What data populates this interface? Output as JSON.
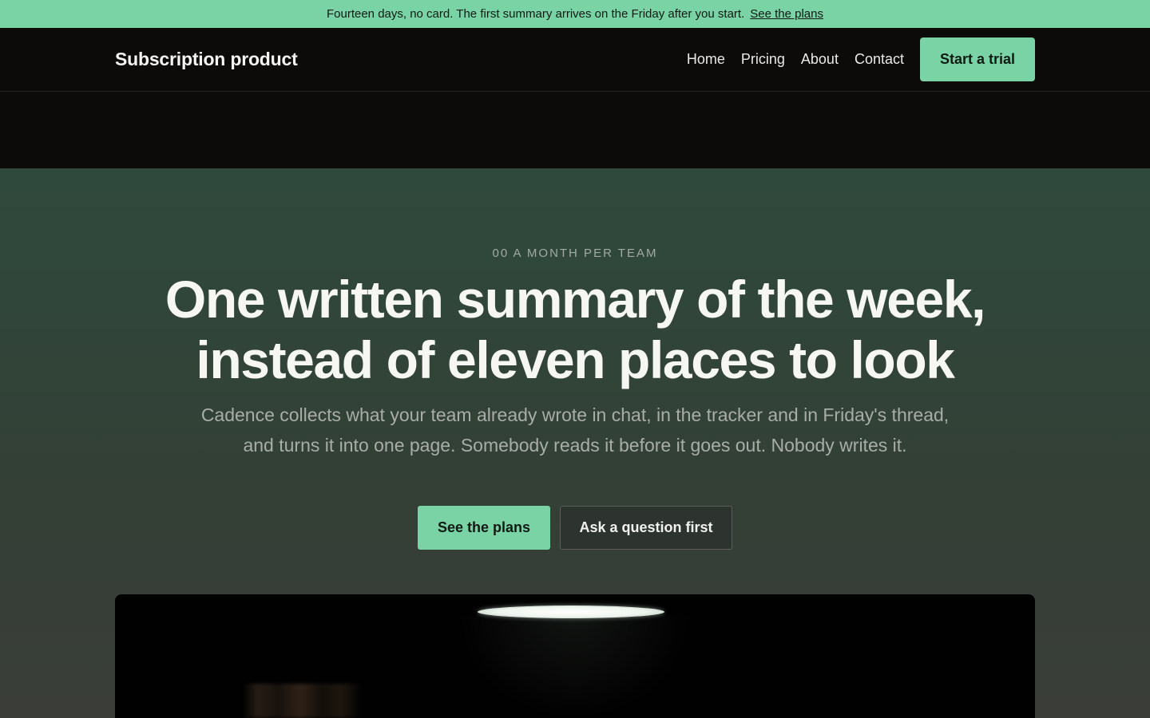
{
  "promo_bar": {
    "message": "Fourteen days, no card. The first summary arrives on the Friday after you start.",
    "link_label": "See the plans"
  },
  "nav": {
    "brand": "Subscription product",
    "links": [
      "Home",
      "Pricing",
      "About",
      "Contact"
    ],
    "cta_label": "Start a trial"
  },
  "hero": {
    "eyebrow": "00 A MONTH PER TEAM",
    "headline": "One written summary of the week, instead of eleven places to look",
    "subtext": "Cadence collects what your team already wrote in chat, in the tracker and in Friday's thread, and turns it into one page. Somebody reads it before it goes out. Nobody writes it.",
    "primary_button": "See the plans",
    "secondary_button": "Ask a question first"
  },
  "colors": {
    "accent": "#7ad3a5",
    "nav_background": "#0c0b09",
    "hero_background": "#2f4a3d"
  }
}
